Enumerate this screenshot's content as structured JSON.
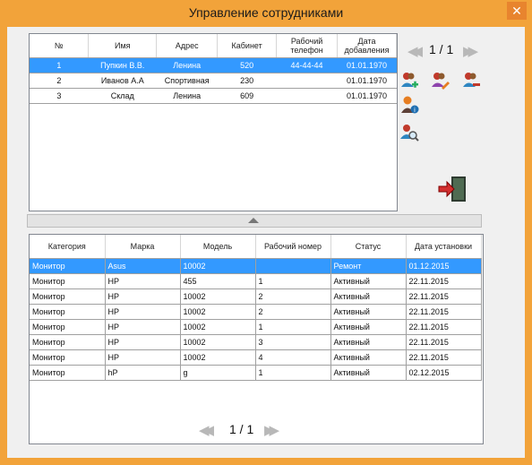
{
  "window": {
    "title": "Управление сотрудниками",
    "close_glyph": "✕"
  },
  "employees": {
    "columns": [
      "№",
      "Имя",
      "Адрес",
      "Кабинет",
      "Рабочий телефон",
      "Дата добавления"
    ],
    "rows": [
      {
        "n": "1",
        "name": "Пупкин В.В.",
        "address": "Ленина",
        "office": "520",
        "phone": "44-44-44",
        "date": "01.01.1970",
        "selected": true
      },
      {
        "n": "2",
        "name": "Иванов А.А",
        "address": "Спортивная",
        "office": "230",
        "phone": "",
        "date": "01.01.1970",
        "selected": false
      },
      {
        "n": "3",
        "name": "Склад",
        "address": "Ленина",
        "office": "609",
        "phone": "",
        "date": "01.01.1970",
        "selected": false
      }
    ],
    "pager": "1 / 1"
  },
  "actions": {
    "icons": [
      "add-user-icon",
      "edit-user-icon",
      "remove-user-icon",
      "user-info-icon",
      "search-user-icon",
      "exit-icon"
    ]
  },
  "equipment": {
    "columns": [
      "Категория",
      "Марка",
      "Модель",
      "Рабочий номер",
      "Статус",
      "Дата установки"
    ],
    "rows": [
      {
        "category": "Монитор",
        "brand": "Asus",
        "model": "10002",
        "number": "",
        "status": "Ремонт",
        "date": "01.12.2015",
        "selected": true
      },
      {
        "category": "Монитор",
        "brand": "HP",
        "model": "455",
        "number": "1",
        "status": "Активный",
        "date": "22.11.2015",
        "selected": false
      },
      {
        "category": "Монитор",
        "brand": "HP",
        "model": "10002",
        "number": "2",
        "status": "Активный",
        "date": "22.11.2015",
        "selected": false
      },
      {
        "category": "Монитор",
        "brand": "HP",
        "model": "10002",
        "number": "2",
        "status": "Активный",
        "date": "22.11.2015",
        "selected": false
      },
      {
        "category": "Монитор",
        "brand": "HP",
        "model": "10002",
        "number": "1",
        "status": "Активный",
        "date": "22.11.2015",
        "selected": false
      },
      {
        "category": "Монитор",
        "brand": "HP",
        "model": "10002",
        "number": "3",
        "status": "Активный",
        "date": "22.11.2015",
        "selected": false
      },
      {
        "category": "Монитор",
        "brand": "HP",
        "model": "10002",
        "number": "4",
        "status": "Активный",
        "date": "22.11.2015",
        "selected": false
      },
      {
        "category": "Монитор",
        "brand": "hP",
        "model": "g",
        "number": "1",
        "status": "Активный",
        "date": "02.12.2015",
        "selected": false
      }
    ],
    "pager": "1 / 1"
  },
  "colors": {
    "accent": "#f2a33a",
    "selection": "#3399ff"
  }
}
